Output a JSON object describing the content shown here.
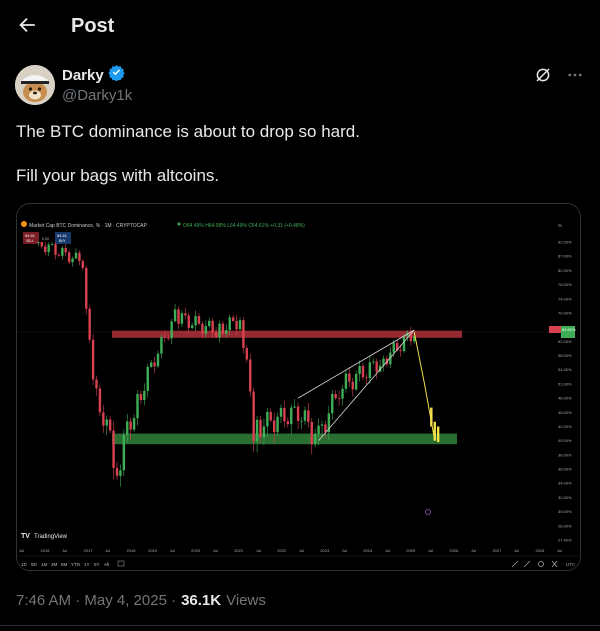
{
  "header": {
    "title": "Post"
  },
  "author": {
    "display_name": "Darky",
    "handle": "@Darky1k"
  },
  "post": {
    "text": "The BTC dominance is about to drop so hard.\n\nFill your bags with altcoins."
  },
  "chart_header": {
    "title": "Market Cap BTC Dominance, % · 1M · CRYPTOCAP",
    "ohlc": "O64.49% H64.98% L64.49% C64.61% +0.31 (+0.48%)",
    "sell_price": "64.61",
    "sell_label": "SELL",
    "spread": "0.00",
    "buy_price": "64.61",
    "buy_label": "BUY",
    "price_tag": "64.61%",
    "pct_symbol": "%"
  },
  "chart_brand": "TradingView",
  "timeframes": [
    "1D",
    "5D",
    "1M",
    "3M",
    "6M",
    "YTD",
    "1Y",
    "5Y",
    "All"
  ],
  "utc_label": "UTC",
  "chart_data": {
    "type": "candlestick",
    "title": "Market Cap BTC Dominance, % · 1M · CRYPTOCAP",
    "y_axis_labels": [
      "92.00%",
      "87.00%",
      "82.00%",
      "78.00%",
      "74.00%",
      "70.00%",
      "66.00%",
      "62.00%",
      "58.00%",
      "54.00%",
      "51.00%",
      "48.00%",
      "45.00%",
      "42.00%",
      "40.00%",
      "38.00%",
      "36.00%",
      "34.00%",
      "32.00%",
      "30.00%",
      "28.00%",
      "27.40%"
    ],
    "x_axis_labels": [
      "Jul",
      "2016",
      "Jul",
      "2017",
      "Jul",
      "2018",
      "2019",
      "Jul",
      "2020",
      "Jul",
      "2021",
      "Jul",
      "2022",
      "Jul",
      "2023",
      "Jul",
      "2024",
      "Jul",
      "2025",
      "Jul",
      "2026",
      "Jul",
      "2027",
      "Jul",
      "2028",
      "Jul"
    ],
    "monthly_close_approx": [
      {
        "date": "2016-01",
        "value": 92
      },
      {
        "date": "2017-03",
        "value": 85
      },
      {
        "date": "2017-06",
        "value": 50
      },
      {
        "date": "2018-01",
        "value": 36
      },
      {
        "date": "2018-06",
        "value": 45
      },
      {
        "date": "2019-06",
        "value": 69
      },
      {
        "date": "2020-06",
        "value": 65
      },
      {
        "date": "2021-01",
        "value": 68
      },
      {
        "date": "2021-05",
        "value": 42
      },
      {
        "date": "2022-06",
        "value": 45
      },
      {
        "date": "2022-12",
        "value": 40
      },
      {
        "date": "2023-06",
        "value": 50
      },
      {
        "date": "2024-06",
        "value": 56
      },
      {
        "date": "2025-04",
        "value": 64.61
      }
    ],
    "projection": [
      {
        "date": "2025-04",
        "value": 64.61
      },
      {
        "date": "2025-07",
        "value": 51
      },
      {
        "date": "2025-10",
        "value": 40
      }
    ],
    "resistance_zone": [
      63,
      65
    ],
    "support_zone": [
      39.5,
      41
    ],
    "current_value": 64.61,
    "colors": {
      "up": "#3eae56",
      "down": "#d9414f",
      "projection": "#f2e04b",
      "resistance": "#b0303a",
      "support": "#2f7a36",
      "wedge": "#d8d8d8"
    }
  }
}
